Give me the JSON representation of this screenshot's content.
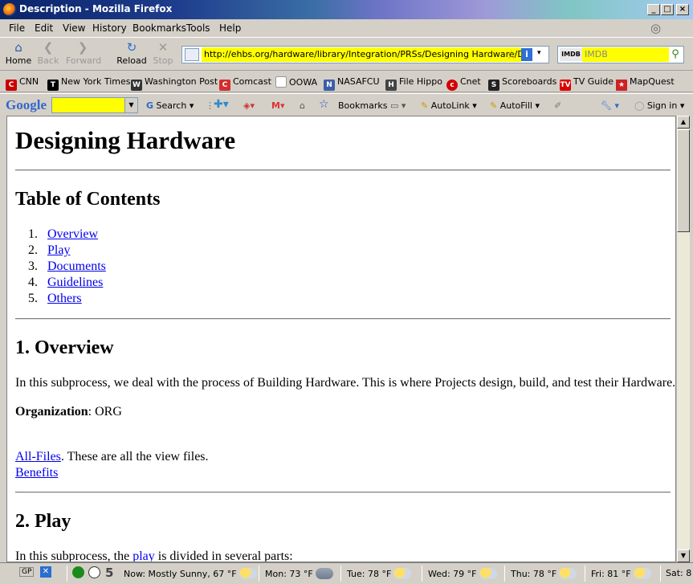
{
  "window": {
    "title": "Description - Mozilla Firefox"
  },
  "menu": [
    "File",
    "Edit",
    "View",
    "History",
    "Bookmarks",
    "Tools",
    "Help"
  ],
  "nav": {
    "home": "Home",
    "back": "Back",
    "forward": "Forward",
    "reload": "Reload",
    "stop": "Stop"
  },
  "url": "http://ehbs.org/hardware/library/Integration/PRSs/Designing Hardware/Desc",
  "search": {
    "engine": "IMDB",
    "placeholder": "IMDB"
  },
  "bookmarks": [
    "CNN",
    "New York Times",
    "Washington Post",
    "Comcast",
    "OOWA",
    "NASAFCU",
    "File Hippo",
    "Cnet",
    "Scoreboards",
    "TV Guide",
    "MapQuest"
  ],
  "google_toolbar": {
    "logo": "Google",
    "search": "Search",
    "bookmarks": "Bookmarks",
    "autolink": "AutoLink",
    "autofill": "AutoFill",
    "signin": "Sign in"
  },
  "page": {
    "title": "Designing Hardware",
    "toc_heading": "Table of Contents",
    "toc": [
      {
        "num": "1.",
        "label": "Overview"
      },
      {
        "num": "2.",
        "label": "Play"
      },
      {
        "num": "3.",
        "label": "Documents"
      },
      {
        "num": "4.",
        "label": "Guidelines"
      },
      {
        "num": "5.",
        "label": "Others"
      }
    ],
    "overview_heading": "1. Overview",
    "overview_text": "In this subprocess, we deal with the process of Building Hardware. This is where Projects design, build, and test their Hardware.",
    "org_label": "Organization",
    "org_value": ": ORG",
    "allfiles_link": "All-Files",
    "allfiles_text": ". These are all the view files.",
    "benefits_link": "Benefits",
    "play_heading": "2. Play",
    "play_text_before": "In this subprocess, the ",
    "play_link": "play",
    "play_text_after": " is divided in several parts:"
  },
  "status": {
    "gp": "GP",
    "count": "5",
    "now": "Now: Mostly Sunny, 67 °F",
    "forecast": [
      "Mon: 73 °F",
      "Tue: 78 °F",
      "Wed: 79 °F",
      "Thu: 78 °F",
      "Fri: 81 °F",
      "Sat: 8"
    ]
  }
}
